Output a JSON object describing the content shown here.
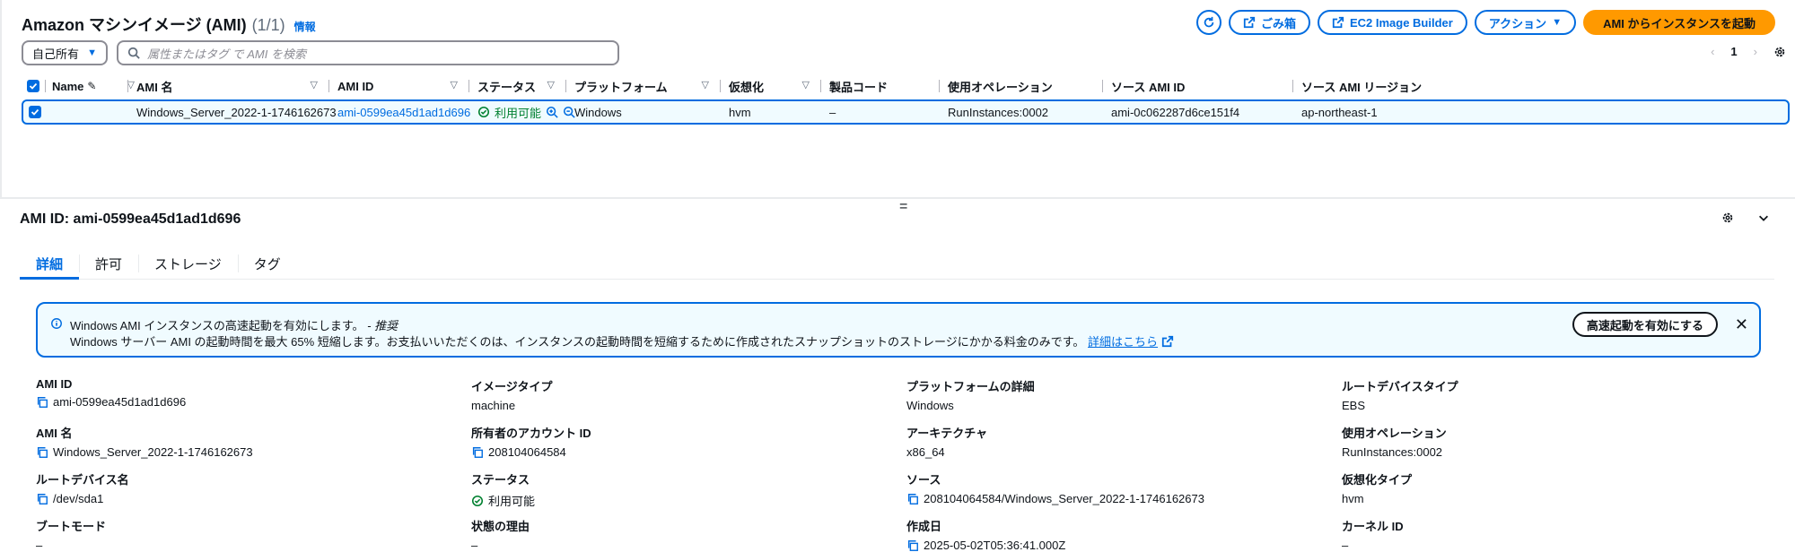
{
  "header": {
    "title": "Amazon マシンイメージ (AMI)",
    "count": "(1/1)",
    "info": "情報"
  },
  "toolbar": {
    "trash_label": "ごみ箱",
    "image_builder_label": "EC2 Image Builder",
    "actions_label": "アクション",
    "launch_label": "AMI からインスタンスを起動"
  },
  "filter": {
    "owner_value": "自己所有",
    "search_placeholder": "属性またはタグ で AMI を検索"
  },
  "pager": {
    "page": "1"
  },
  "table": {
    "columns": [
      "Name",
      "AMI 名",
      "AMI ID",
      "ステータス",
      "プラットフォーム",
      "仮想化",
      "製品コード",
      "使用オペレーション",
      "ソース AMI ID",
      "ソース AMI リージョン"
    ],
    "row": {
      "name": "",
      "ami_name": "Windows_Server_2022-1-1746162673",
      "ami_id": "ami-0599ea45d1ad1d696",
      "status": "利用可能",
      "platform": "Windows",
      "virtualization": "hvm",
      "product_code": "–",
      "usage_operation": "RunInstances:0002",
      "source_ami_id": "ami-0c062287d6ce151f4",
      "source_region": "ap-northeast-1"
    }
  },
  "detail": {
    "title": "AMI ID: ami-0599ea45d1ad1d696",
    "tabs": [
      "詳細",
      "許可",
      "ストレージ",
      "タグ"
    ],
    "alert": {
      "line1": "Windows AMI インスタンスの高速起動を有効にします。",
      "line1_rec": "- 推奨",
      "line2": "Windows サーバー AMI の起動時間を最大 65% 短縮します。お支払いいただくのは、インスタンスの起動時間を短縮するために作成されたスナップショットのストレージにかかる料金のみです。",
      "link": "詳細はこちら",
      "button": "高速起動を有効にする"
    },
    "fields": {
      "ami_id_k": "AMI ID",
      "ami_id_v": "ami-0599ea45d1ad1d696",
      "image_type_k": "イメージタイプ",
      "image_type_v": "machine",
      "platform_k": "プラットフォームの詳細",
      "platform_v": "Windows",
      "root_type_k": "ルートデバイスタイプ",
      "root_type_v": "EBS",
      "ami_name_k": "AMI 名",
      "ami_name_v": "Windows_Server_2022-1-1746162673",
      "owner_k": "所有者のアカウント ID",
      "owner_v": "208104064584",
      "arch_k": "アーキテクチャ",
      "arch_v": "x86_64",
      "usage_k": "使用オペレーション",
      "usage_v": "RunInstances:0002",
      "root_name_k": "ルートデバイス名",
      "root_name_v": "/dev/sda1",
      "status_k": "ステータス",
      "status_v": "利用可能",
      "source_k": "ソース",
      "source_v": "208104064584/Windows_Server_2022-1-1746162673",
      "virt_k": "仮想化タイプ",
      "virt_v": "hvm",
      "boot_k": "ブートモード",
      "boot_v": "–",
      "reason_k": "状態の理由",
      "reason_v": "–",
      "created_k": "作成日",
      "created_v": "2025-05-02T05:36:41.000Z",
      "kernel_k": "カーネル ID",
      "kernel_v": "–"
    }
  },
  "colors": {
    "accent": "#006ce0",
    "primary": "#ff9900",
    "success": "#00802f"
  }
}
